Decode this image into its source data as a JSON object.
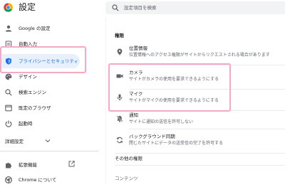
{
  "app": {
    "title": "設定"
  },
  "search": {
    "placeholder": "設定項目を検索"
  },
  "sidebar": {
    "items": [
      {
        "label": "Google の設定",
        "icon": "person-icon"
      },
      {
        "label": "自動入力",
        "icon": "clipboard-icon"
      },
      {
        "label": "プライバシーとセキュリティ",
        "icon": "shield-icon"
      },
      {
        "label": "デザイン",
        "icon": "palette-icon"
      },
      {
        "label": "検索エンジン",
        "icon": "search-icon"
      },
      {
        "label": "既定のブラウザ",
        "icon": "browser-icon"
      },
      {
        "label": "起動時",
        "icon": "power-icon"
      }
    ],
    "advanced_label": "詳細設定",
    "extensions_label": "拡張機能",
    "about_label": "Chrome について"
  },
  "main": {
    "permissions_header": "権限",
    "permissions": [
      {
        "title": "位置情報",
        "subtitle": "位置情報へのアクセス権限がサイトからリクエストされる場合があります",
        "icon": "location-pin-icon"
      },
      {
        "title": "カメラ",
        "subtitle": "サイトがカメラの使用を要求できるようにする",
        "icon": "camera-icon"
      },
      {
        "title": "マイク",
        "subtitle": "サイトがマイクの使用を要求できるようにする",
        "icon": "microphone-icon"
      },
      {
        "title": "通知",
        "subtitle": "サイトに通知の送信を許可しない",
        "icon": "bell-icon"
      },
      {
        "title": "バックグラウンド同期",
        "subtitle": "閉じたサイトにデータの送受信の完了を許可する",
        "icon": "sync-icon"
      }
    ],
    "other_permissions": "その他の権限",
    "contents_header": "コンテンツ"
  },
  "colors": {
    "accent": "#1a73e8",
    "highlight": "#f5a9c9",
    "active_bg": "#e8f0fe"
  }
}
